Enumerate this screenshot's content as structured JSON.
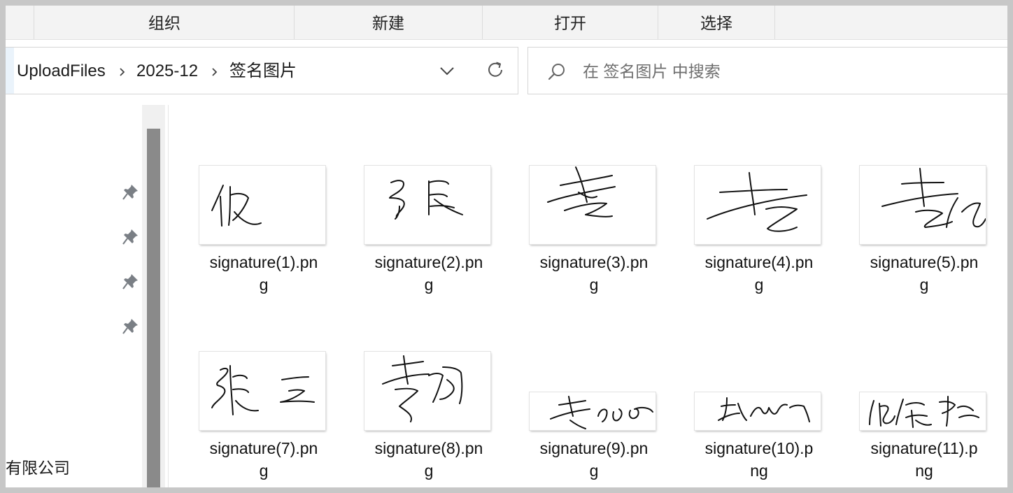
{
  "command_bar": {
    "organize": "组织",
    "new": "新建",
    "open": "打开",
    "select": "选择"
  },
  "address_bar": {
    "crumbs": [
      "UploadFiles",
      "2025-12",
      "签名图片"
    ],
    "icons": {
      "separator": "chevron-right-icon",
      "dropdown": "chevron-down-icon",
      "refresh": "refresh-icon"
    }
  },
  "search": {
    "placeholder": "在 签名图片 中搜索",
    "value": "",
    "icon": "search-icon"
  },
  "nav_pane": {
    "pinned_icon": "pin-icon",
    "partial_label": "有限公司"
  },
  "files": [
    {
      "name_line1": "signature(1).pn",
      "name_line2": "g"
    },
    {
      "name_line1": "signature(2).pn",
      "name_line2": "g"
    },
    {
      "name_line1": "signature(3).pn",
      "name_line2": "g"
    },
    {
      "name_line1": "signature(4).pn",
      "name_line2": "g"
    },
    {
      "name_line1": "signature(5).pn",
      "name_line2": "g"
    },
    {
      "name_line1": "signature(7).pn",
      "name_line2": "g"
    },
    {
      "name_line1": "signature(8).pn",
      "name_line2": "g"
    },
    {
      "name_line1": "signature(9).pn",
      "name_line2": "g"
    },
    {
      "name_line1": "signature(10).p",
      "name_line2": "ng"
    },
    {
      "name_line1": "signature(11).p",
      "name_line2": "ng"
    }
  ],
  "colors": {
    "background": "#ffffff",
    "command_bar": "#f3f3f3",
    "border": "#d6d6d6",
    "scroll_thumb": "#8a8a8a",
    "text": "#1b1b1b"
  }
}
